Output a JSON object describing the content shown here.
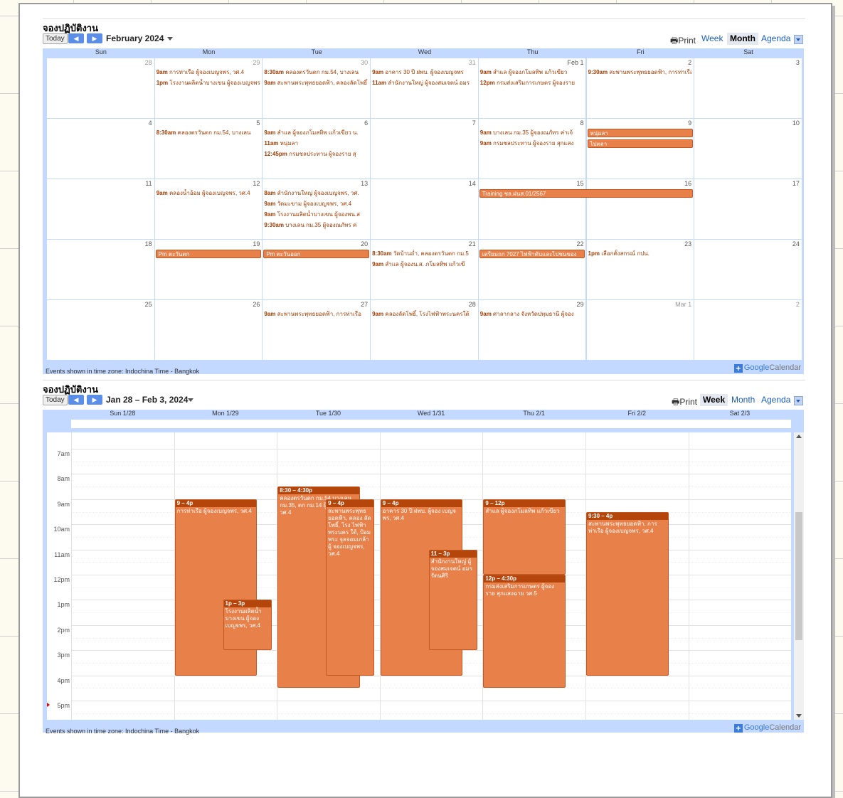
{
  "month_view": {
    "title": "จองปฏิบัติงาน",
    "today_label": "Today",
    "date_range": "February 2024",
    "print_label": "Print",
    "tabs": [
      "Week",
      "Month",
      "Agenda"
    ],
    "selected_tab": "Month",
    "day_headers": [
      "Sun",
      "Mon",
      "Tue",
      "Wed",
      "Thu",
      "Fri",
      "Sat"
    ],
    "weeks": [
      [
        "28",
        "29",
        "30",
        "31",
        "Feb 1",
        "2",
        "3"
      ],
      [
        "4",
        "5",
        "6",
        "7",
        "8",
        "9",
        "10"
      ],
      [
        "11",
        "12",
        "13",
        "14",
        "15",
        "16",
        "17"
      ],
      [
        "18",
        "19",
        "20",
        "21",
        "22",
        "23",
        "24"
      ],
      [
        "25",
        "26",
        "27",
        "28",
        "29",
        "Mar 1",
        "2"
      ]
    ],
    "timezone_note": "Events shown in time zone: Indochina Time - Bangkok",
    "events": [
      {
        "week": 0,
        "day": 1,
        "line": 0,
        "time": "9am",
        "text": "การท่าเรือ ผู้จองเบญจพร, วศ.4"
      },
      {
        "week": 0,
        "day": 1,
        "line": 1,
        "time": "1pm",
        "text": "โรงงานผลิตน้ำบางเขน ผู้จองเบญจพร"
      },
      {
        "week": 0,
        "day": 2,
        "line": 0,
        "time": "8:30am",
        "text": "คลองตรวันตก กม.54, บางเลน"
      },
      {
        "week": 0,
        "day": 2,
        "line": 1,
        "time": "9am",
        "text": "สะพานพระพุทธยอดฟ้า, คลองลัดโพธิ์"
      },
      {
        "week": 0,
        "day": 3,
        "line": 0,
        "time": "9am",
        "text": "อาคาร 30 ปี ฝพบ. ผู้จองเบญจพร"
      },
      {
        "week": 0,
        "day": 3,
        "line": 1,
        "time": "11am",
        "text": "สำนักงานใหญ่ ผู้จองสมเจตน์ อมร"
      },
      {
        "week": 0,
        "day": 4,
        "line": 0,
        "time": "9am",
        "text": "สำแล ผู้จองภโมลทิพ แก้วเขียว"
      },
      {
        "week": 0,
        "day": 4,
        "line": 1,
        "time": "12pm",
        "text": "กรมส่งเสริมการเกษตร ผู้จองราย"
      },
      {
        "week": 0,
        "day": 5,
        "line": 0,
        "time": "9:30am",
        "text": "สะพานพระพุทธยอดฟ้า, การท่าเรือ"
      },
      {
        "week": 1,
        "day": 1,
        "line": 0,
        "time": "8:30am",
        "text": "คลองตรวันตก กม.54, บางเลน"
      },
      {
        "week": 1,
        "day": 2,
        "line": 0,
        "time": "9am",
        "text": "สำแล ผู้จองภโมลทิพ แก้วเขียว น."
      },
      {
        "week": 1,
        "day": 2,
        "line": 1,
        "time": "11am",
        "text": "หนุ่มลา"
      },
      {
        "week": 1,
        "day": 2,
        "line": 2,
        "time": "12:45pm",
        "text": "กรมชลประทาน ผู้จองราย สุ"
      },
      {
        "week": 1,
        "day": 4,
        "line": 0,
        "time": "9am",
        "text": "บางเลน กม.35 ผู้จองณภัทร ค่าเจ้"
      },
      {
        "week": 1,
        "day": 4,
        "line": 1,
        "time": "9am",
        "text": "กรมชลประทาน ผู้จองราย สุกแสง"
      },
      {
        "week": 2,
        "day": 1,
        "line": 0,
        "time": "9am",
        "text": "คลองน้ำอ้อม ผู้จองเบญจพร, วศ.4"
      },
      {
        "week": 2,
        "day": 2,
        "line": 0,
        "time": "8am",
        "text": "สำนักงานใหญ่ ผู้จองเบญจพร, วศ."
      },
      {
        "week": 2,
        "day": 2,
        "line": 1,
        "time": "9am",
        "text": "วัดมะขาม ผู้จองเบญจพร, วศ.4"
      },
      {
        "week": 2,
        "day": 2,
        "line": 2,
        "time": "9am",
        "text": "โรงงานผลิตน้ำบางเขน ผู้จองพน.ส"
      },
      {
        "week": 2,
        "day": 2,
        "line": 3,
        "time": "9:30am",
        "text": "บางเลน กม.35 ผู้จองณภัทร ค่"
      },
      {
        "week": 3,
        "day": 3,
        "line": 0,
        "time": "8:30am",
        "text": "วัดบ้านถ่ำ, คลองตรวันตก กม.5"
      },
      {
        "week": 3,
        "day": 3,
        "line": 1,
        "time": "9am",
        "text": "สำแล ผู้จองน.ส. ภโมลทิพ แก้วเขี"
      },
      {
        "week": 3,
        "day": 5,
        "line": 0,
        "time": "1pm",
        "text": "เลือกตั้งสกรณ์ กปน."
      },
      {
        "week": 4,
        "day": 2,
        "line": 0,
        "time": "9am",
        "text": "สะพานพระพุทธยอดฟ้า, การท่าเรือ"
      },
      {
        "week": 4,
        "day": 3,
        "line": 0,
        "time": "9am",
        "text": "คลองลัดโพธิ์, โรงไฟฟ้าพระนครใต้"
      },
      {
        "week": 4,
        "day": 4,
        "line": 0,
        "time": "9am",
        "text": "ศาลากลาง จังหวัดปทุมธานี ผู้จอง"
      }
    ],
    "bars": [
      {
        "week": 1,
        "start": 5,
        "span": 1,
        "line": 0,
        "text": "หนุ่มลา"
      },
      {
        "week": 1,
        "start": 5,
        "span": 1,
        "line": 1,
        "text": "ไปตลา"
      },
      {
        "week": 2,
        "start": 4,
        "span": 2,
        "line": 0,
        "text": "Training ชล.ฝนส.01/2567"
      },
      {
        "week": 3,
        "start": 1,
        "span": 1,
        "line": 0,
        "text": "Pm ตะวันตก"
      },
      {
        "week": 3,
        "start": 2,
        "span": 1,
        "line": 0,
        "text": "Pm ตะวันออก"
      },
      {
        "week": 3,
        "start": 4,
        "span": 1,
        "line": 0,
        "text": "เตรียมถก 7027 ไฟฟ้าดับและไปชนของ"
      }
    ]
  },
  "week_view": {
    "title": "จองปฏิบัติงาน",
    "today_label": "Today",
    "date_range": "Jan 28 – Feb 3, 2024",
    "print_label": "Print",
    "tabs": [
      "Week",
      "Month",
      "Agenda"
    ],
    "selected_tab": "Week",
    "day_headers": [
      "Sun 1/28",
      "Mon 1/29",
      "Tue 1/30",
      "Wed 1/31",
      "Thu 2/1",
      "Fri 2/2",
      "Sat 2/3"
    ],
    "hours": [
      "7am",
      "8am",
      "9am",
      "10am",
      "11am",
      "12pm",
      "1pm",
      "2pm",
      "3pm",
      "4pm",
      "5pm"
    ],
    "timezone_note": "Events shown in time zone: Indochina Time - Bangkok",
    "events": [
      {
        "day": 1,
        "start": 9,
        "end": 16,
        "col": 0,
        "cols": 1,
        "time": "9 – 4p",
        "text": "การท่าเรือ ผู้จองเบญจพร, วศ.4"
      },
      {
        "day": 1,
        "start": 13,
        "end": 15,
        "col": 1,
        "cols": 2,
        "time": "1p – 3p",
        "text": "โรงงานผลิตน้ำ บางเขน ผู้จอง เบญจพร, วศ.4"
      },
      {
        "day": 2,
        "start": 8.5,
        "end": 16.5,
        "col": 0,
        "cols": 1,
        "time": "8:30 – 4:30p",
        "text": "คลองตรวันตก กม.54 บางเลน กม.35, ตก กม.14 ผู้จอง เวียน, วศ.4"
      },
      {
        "day": 2,
        "start": 9,
        "end": 16,
        "col": 1,
        "cols": 2,
        "time": "9 – 4p",
        "text": "สะพานพระพุทธ ยอดฟ้า, คลอง ลัดโพธิ์, โรง ไฟฟ้าพระนคร ใต้, ป้อมพระ จุลจอมเกล้า ผู้ จองเบญจพร, วศ.4"
      },
      {
        "day": 3,
        "start": 9,
        "end": 16,
        "col": 0,
        "cols": 1,
        "time": "9 – 4p",
        "text": "อาคาร 30 ปี ฝพบ. ผู้จอง เบญจพร, วศ.4"
      },
      {
        "day": 3,
        "start": 11,
        "end": 15,
        "col": 1,
        "cols": 2,
        "time": "11 – 3p",
        "text": "สำนักงานใหญ่ ผู้ จองสมเจตน์ อมร รัตนศิริ"
      },
      {
        "day": 4,
        "start": 9,
        "end": 12,
        "col": 0,
        "cols": 1,
        "time": "9 – 12p",
        "text": "สำแล ผู้จองภโมลทิพ แก้วเขียว"
      },
      {
        "day": 4,
        "start": 12,
        "end": 16.5,
        "col": 0,
        "cols": 1,
        "time": "12p – 4:30p",
        "text": "กรมส่งเสริมการเกษตร ผู้จองราย สุกแสงฉาย วศ.5"
      },
      {
        "day": 5,
        "start": 9.5,
        "end": 16,
        "col": 0,
        "cols": 1,
        "time": "9:30 – 4p",
        "text": "สะพานพระพุทธยอดฟ้า, การท่าเรือ ผู้จองเบญจพร, วศ.4"
      }
    ]
  },
  "brand": {
    "google": "Google",
    "calendar": "Calendar"
  },
  "colors": {
    "event_bg": "#e8804a",
    "event_title": "#b4460c",
    "event_text_month": "#a33b00",
    "header_bg": "#c3d9ff"
  },
  "icons": {
    "print": "printer-icon",
    "prev": "chevron-left-icon",
    "next": "chevron-right-icon",
    "menu": "chevron-down-icon"
  }
}
